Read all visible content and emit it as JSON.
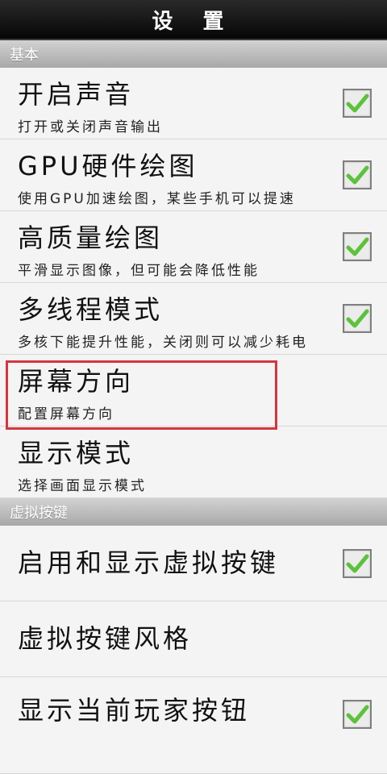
{
  "title": "设 置",
  "sections": [
    {
      "header": "基本",
      "items": [
        {
          "title": "开启声音",
          "summary": "打开或关闭声音输出",
          "checked": true
        },
        {
          "title": "GPU硬件绘图",
          "summary": "使用GPU加速绘图，某些手机可以提速",
          "checked": true
        },
        {
          "title": "高质量绘图",
          "summary": "平滑显示图像，但可能会降低性能",
          "checked": true
        },
        {
          "title": "多线程模式",
          "summary": "多核下能提升性能，关闭则可以减少耗电",
          "checked": true
        },
        {
          "title": "屏幕方向",
          "summary": "配置屏幕方向",
          "checked": null
        },
        {
          "title": "显示模式",
          "summary": "选择画面显示模式",
          "checked": null
        }
      ]
    },
    {
      "header": "虚拟按键",
      "items": [
        {
          "title": "启用和显示虚拟按键",
          "checked": true
        },
        {
          "title": "虚拟按键风格",
          "checked": null
        },
        {
          "title": "显示当前玩家按钮",
          "checked": true
        }
      ]
    }
  ],
  "colors": {
    "check": "#5cc23a",
    "highlight": "#d8343c"
  }
}
